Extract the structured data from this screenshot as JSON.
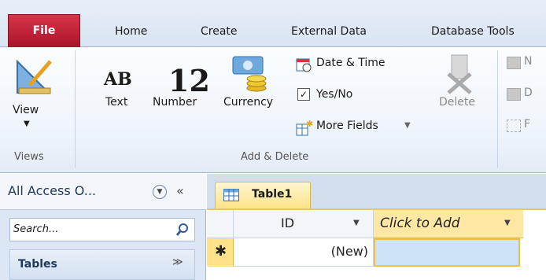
{
  "tabs": [
    "File",
    "Home",
    "Create",
    "External Data",
    "Database Tools"
  ],
  "groups": {
    "views": {
      "label": "Views",
      "view_button": "View"
    },
    "add_delete": {
      "label": "Add & Delete",
      "text_glyph": "AB",
      "text_label": "Text",
      "number_glyph": "12",
      "number_label": "Number",
      "currency_label": "Currency",
      "date_time": "Date & Time",
      "yes_no": "Yes/No",
      "more_fields": "More Fields",
      "delete": "Delete"
    },
    "partial_letters": [
      "N",
      "D",
      "F"
    ]
  },
  "nav": {
    "title": "All Access O...",
    "search_placeholder": "Search...",
    "section": "Tables"
  },
  "document": {
    "tab_label": "Table1",
    "columns": [
      "ID",
      "Click to Add"
    ],
    "new_row": {
      "marker": "✱",
      "id": "(New)"
    }
  },
  "colors": {
    "file_tab": "#c0203a",
    "accent_yellow": "#ffe28a",
    "selected_cell": "#cfe3f7"
  }
}
